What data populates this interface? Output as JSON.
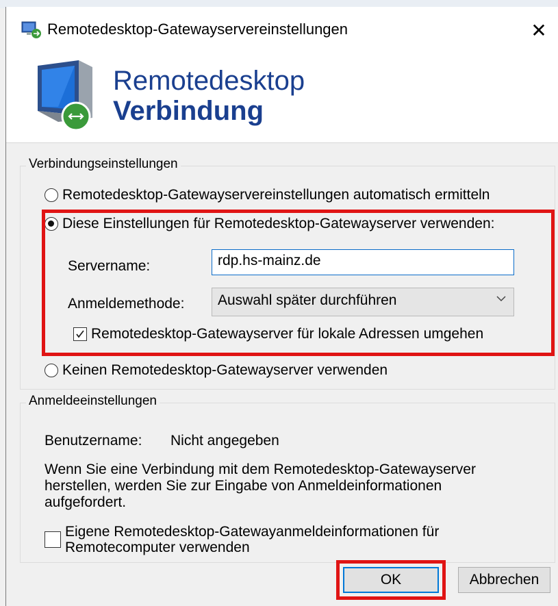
{
  "window": {
    "title": "Remotedesktop-Gatewayservereinstellungen",
    "close_glyph": "✕"
  },
  "banner": {
    "line1": "Remotedesktop",
    "line2": "Verbindung"
  },
  "connection": {
    "legend": "Verbindungseinstellungen",
    "option_auto": "Remotedesktop-Gatewayservereinstellungen automatisch ermitteln",
    "option_use": "Diese Einstellungen für Remotedesktop-Gatewayserver verwenden:",
    "server_label": "Servername:",
    "server_value": "rdp.hs-mainz.de",
    "method_label": "Anmeldemethode:",
    "method_value": "Auswahl später durchführen",
    "bypass_label": "Remotedesktop-Gatewayserver für lokale Adressen umgehen",
    "option_none": "Keinen Remotedesktop-Gatewayserver verwenden",
    "selected_option": "use",
    "bypass_checked": true
  },
  "login": {
    "legend": "Anmeldeeinstellungen",
    "user_label": "Benutzername:",
    "user_value": "Nicht angegeben",
    "info_line1": "Wenn Sie eine Verbindung mit dem Remotedesktop-Gatewayserver",
    "info_line2": "herstellen, werden Sie zur Eingabe von Anmeldeinformationen",
    "info_line3": "aufgefordert.",
    "own_creds_line1": "Eigene Remotedesktop-Gatewayanmeldeinformationen für",
    "own_creds_line2": "Remotecomputer verwenden",
    "own_creds_checked": false
  },
  "buttons": {
    "ok": "OK",
    "cancel": "Abbrechen"
  },
  "colors": {
    "highlight": "#e01414",
    "title_blue": "#1a3f8f",
    "focus_blue": "#0078d7"
  },
  "icons": {
    "title": "remote-desktop-icon",
    "banner": "monitor-remote-icon",
    "chevron": "chevron-down-icon"
  }
}
